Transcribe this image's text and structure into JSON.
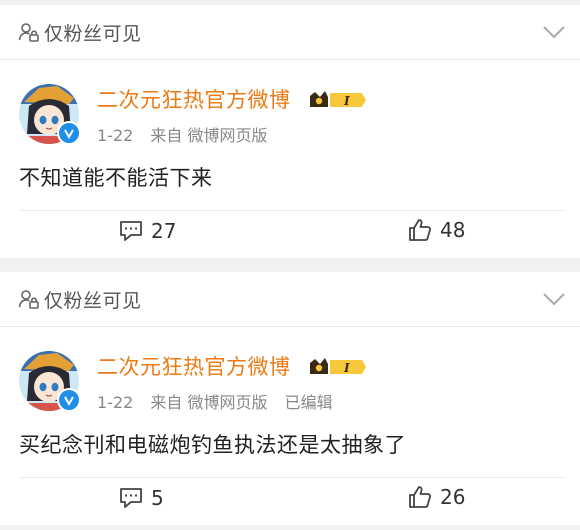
{
  "posts": [
    {
      "privacy_label": "仅粉丝可见",
      "author": "二次元狂热官方微博",
      "vip_level": "I",
      "date": "1-22",
      "source": "来自 微博网页版",
      "edited": "",
      "text": "不知道能不能活下来",
      "comments": "27",
      "likes": "48"
    },
    {
      "privacy_label": "仅粉丝可见",
      "author": "二次元狂热官方微博",
      "vip_level": "I",
      "date": "1-22",
      "source": "来自 微博网页版",
      "edited": "已编辑",
      "text": "买纪念刊和电磁炮钓鱼执法还是太抽象了",
      "comments": "5",
      "likes": "26"
    }
  ],
  "colors": {
    "author": "#ed7a12",
    "verified": "#1f8fe8",
    "background": "#f1f1f1"
  },
  "icons": {
    "privacy": "lock-person-icon",
    "expand": "chevron-down-icon",
    "comment": "comment-bubble-icon",
    "like": "thumbs-up-icon",
    "verified": "verified-v-icon",
    "vip": "crown-level-badge-icon"
  }
}
